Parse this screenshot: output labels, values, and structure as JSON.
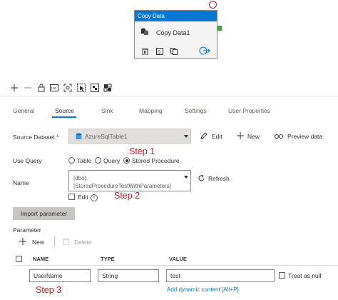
{
  "activity": {
    "header": "Copy Data",
    "name": "Copy Data1",
    "status_color": "#3da541"
  },
  "canvas_toolbar": {
    "icons": [
      "plus-icon",
      "minus-icon",
      "lock-icon",
      "zoom-100-icon",
      "zoom-fit-icon",
      "select-icon",
      "auto-align-icon",
      "layers-icon"
    ],
    "zoom_label": "100"
  },
  "tabs": [
    "General",
    "Source",
    "Sink",
    "Mapping",
    "Settings",
    "User Properties"
  ],
  "active_tab": "Source",
  "source": {
    "dataset_label": "Source Dataset",
    "required_mark": "*",
    "dataset_value": "AzureSqlTable1",
    "edit_label": "Edit",
    "new_label": "New",
    "preview_label": "Preview data",
    "use_query_label": "Use Query",
    "query_options": [
      "Table",
      "Query",
      "Stored Procedure"
    ],
    "selected_query": "Stored Procedure",
    "name_label": "Name",
    "name_value_line1": "[dbo].",
    "name_value_line2": "[StoredProcedureTestWithParameters]",
    "refresh_label": "Refresh",
    "edit_checkbox_label": "Edit",
    "info_glyph": "i",
    "import_label": "Import parameter",
    "parameter_label": "Parameter",
    "param_new_label": "New",
    "param_delete_label": "Delete"
  },
  "param_table": {
    "columns": [
      "NAME",
      "TYPE",
      "VALUE"
    ],
    "rows": [
      {
        "name": "UserName",
        "type": "String",
        "value": "test",
        "dynamic_link": "Add dynamic content [Alt+P]",
        "null_label": "Treat as null"
      }
    ]
  },
  "annotations": [
    "Step 1",
    "Step 2",
    "Step 3"
  ],
  "colors": {
    "accent": "#0078d4",
    "annotation": "#e81123"
  }
}
